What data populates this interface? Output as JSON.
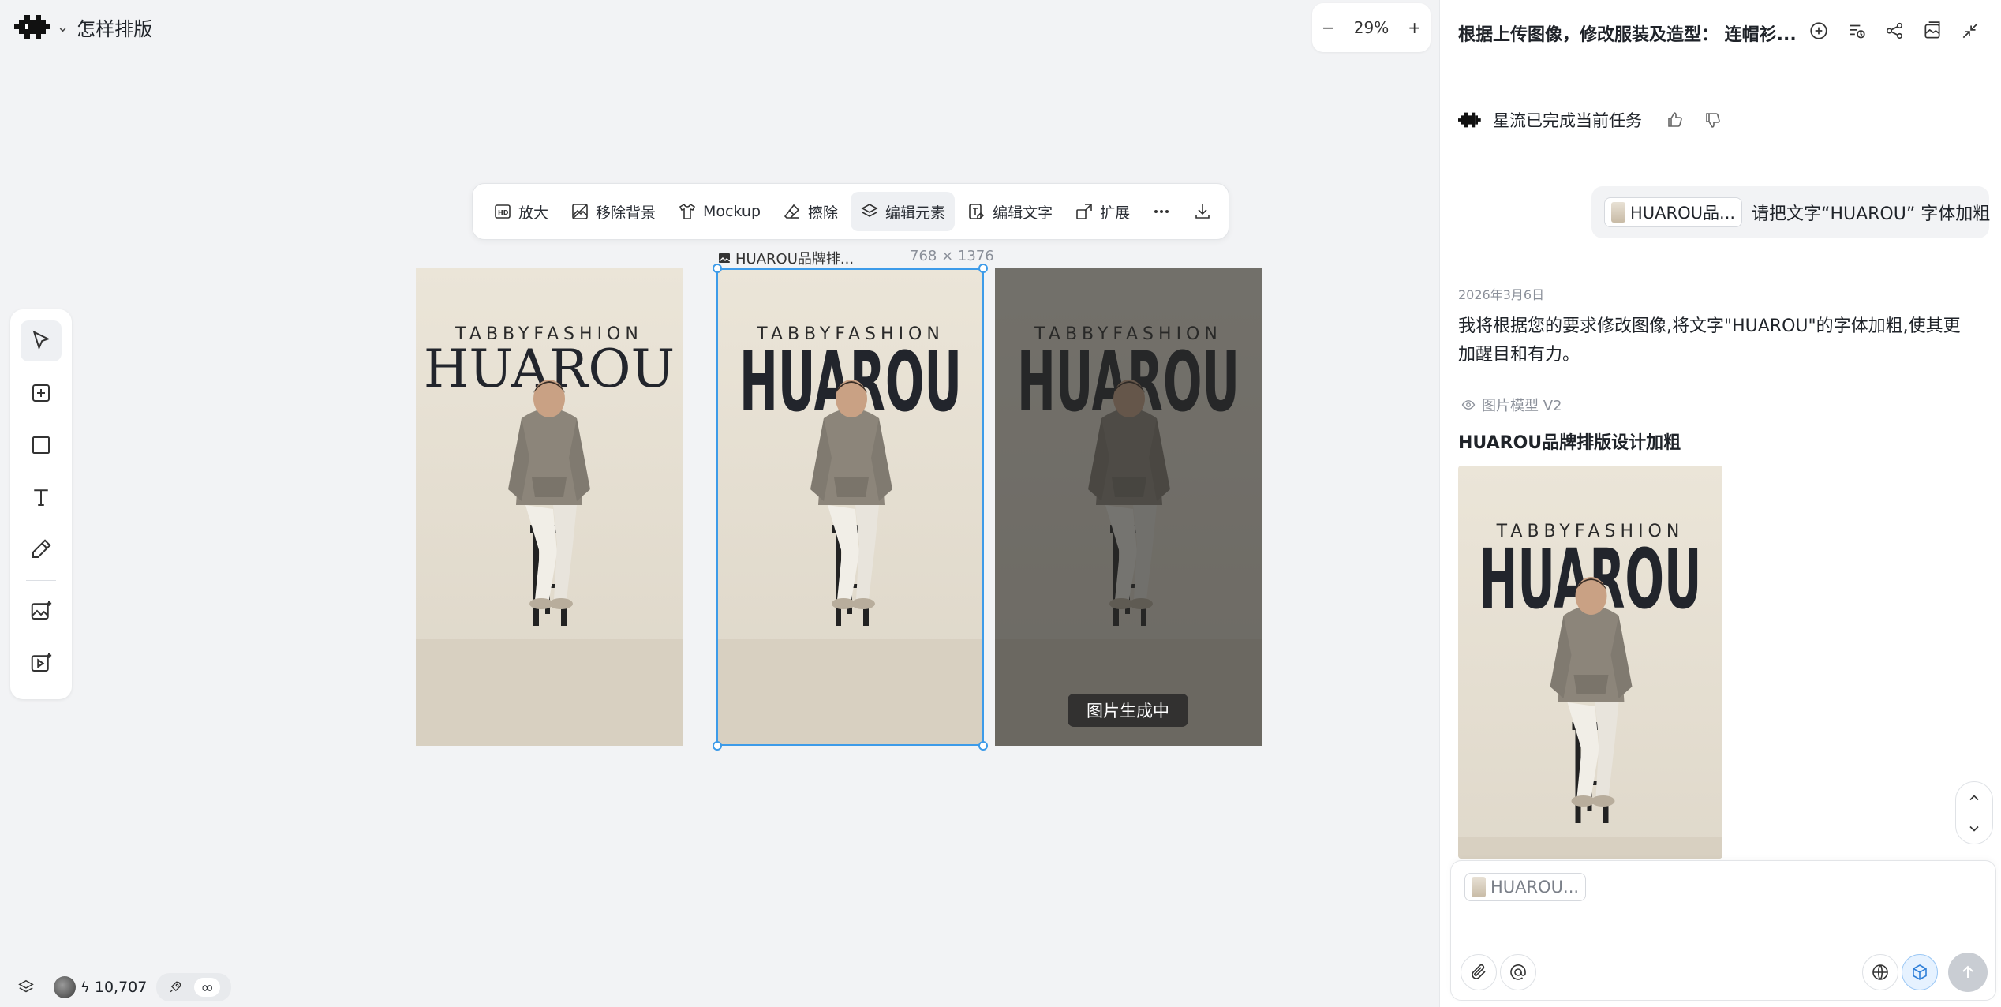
{
  "project": {
    "name": "怎样排版",
    "logo_icon": "xingliu-logo-icon",
    "dropdown_icon": "chevron-down-icon"
  },
  "zoom": {
    "minus": "−",
    "value": "29%",
    "plus": "+"
  },
  "toolbar": {
    "items": [
      {
        "label": "放大",
        "icon": "hd-icon"
      },
      {
        "label": "移除背景",
        "icon": "remove-bg-icon"
      },
      {
        "label": "Mockup",
        "icon": "tshirt-icon"
      },
      {
        "label": "擦除",
        "icon": "eraser-icon"
      },
      {
        "label": "编辑元素",
        "icon": "layers-icon",
        "active": true
      },
      {
        "label": "编辑文字",
        "icon": "text-edit-icon"
      },
      {
        "label": "扩展",
        "icon": "expand-icon"
      }
    ],
    "more": "more-icon",
    "download": "download-icon"
  },
  "canvas": {
    "selected_label": "HUAROU品牌排...",
    "selected_size": "768 × 1376",
    "generating_label": "图片生成中",
    "poster_brand": "TABBYFASHION",
    "poster_title": "HUAROU"
  },
  "left_tools": [
    "select-pointer-icon",
    "add-frame-icon",
    "rectangle-icon",
    "text-tool-icon",
    "pen-icon",
    "image-generate-icon",
    "video-generate-icon"
  ],
  "status_bar": {
    "layers_icon": "layers-icon",
    "credits": "10,707",
    "rocket_icon": "rocket-icon",
    "infinity": "∞"
  },
  "chat": {
    "header_title": "根据上传图像，修改服装及造型：  连帽衫...",
    "header_icons": [
      "new-chat-icon",
      "history-icon",
      "share-icon",
      "assets-icon",
      "collapse-icon"
    ],
    "done_text": "星流已完成当前任务",
    "user_message": {
      "chip": "HUAROU品...",
      "text": "请把文字“HUAROU” 字体加粗"
    },
    "date": "2026年3月6日",
    "reply": "我将根据您的要求修改图像,将文字\"HUAROU\"的字体加粗,使其更加醒目和有力。",
    "model_label": "图片模型 V2",
    "result_title": "HUAROU品牌排版设计加粗",
    "input_chip": "HUAROU..."
  },
  "colors": {
    "selection": "#3d9be9",
    "poster_bg": "#e9e3d6",
    "panel_bg": "#ffffff",
    "canvas_bg": "#f2f3f5"
  }
}
